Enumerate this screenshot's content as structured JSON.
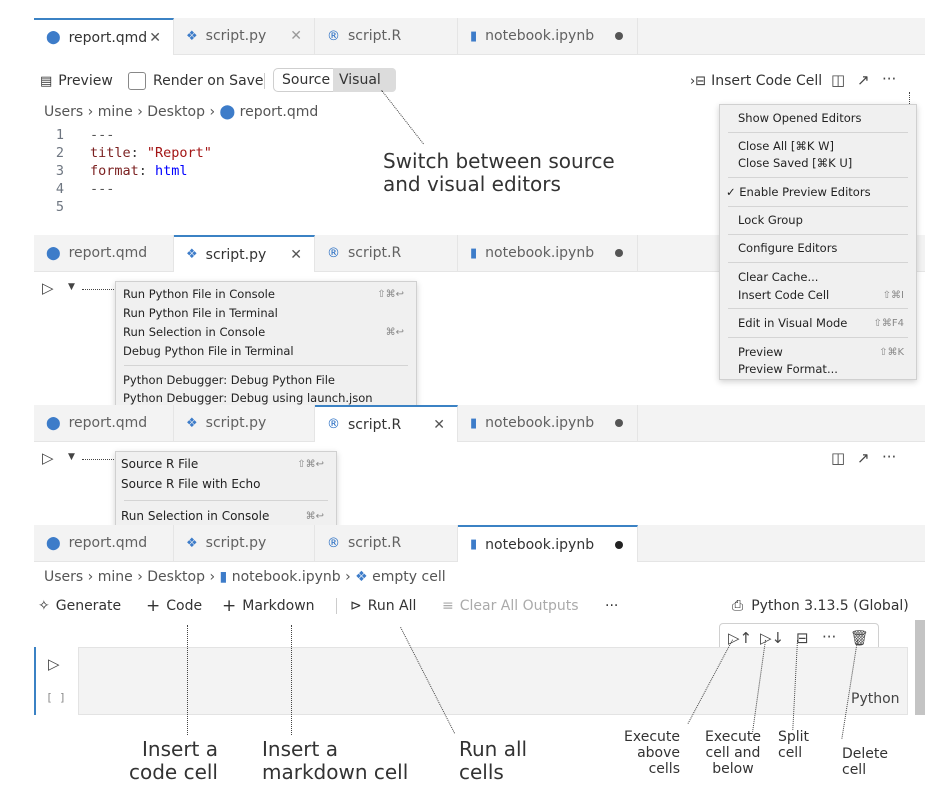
{
  "panel1": {
    "tabs": [
      {
        "label": "report.qmd",
        "close": "✕"
      },
      {
        "label": "script.py",
        "close": "✕"
      },
      {
        "label": "script.R"
      },
      {
        "label": "notebook.ipynb"
      }
    ],
    "toolbar": {
      "preview": "Preview",
      "render_on_save": "Render on Save",
      "source": "Source",
      "visual": "Visual",
      "insert_code_cell": "Insert Code Cell",
      "more": "···"
    },
    "breadcrumb": [
      "Users",
      "mine",
      "Desktop",
      "report.qmd"
    ],
    "code": [
      {
        "n": "1",
        "text": "---"
      },
      {
        "n": "2",
        "key": "title",
        "val": "\"Report\""
      },
      {
        "n": "3",
        "key": "format",
        "val": "html"
      },
      {
        "n": "4",
        "text": "---"
      },
      {
        "n": "5",
        "text": ""
      }
    ],
    "more_menu": [
      {
        "label": "Show Opened Editors",
        "sc": ""
      },
      {
        "label": "Close All [⌘K W]",
        "sc": ""
      },
      {
        "label": "Close Saved [⌘K U]",
        "sc": ""
      },
      {
        "label": "✓ Enable Preview Editors",
        "sc": ""
      },
      {
        "label": "Lock Group",
        "sc": ""
      },
      {
        "label": "Configure Editors",
        "sc": ""
      },
      {
        "label": "Clear Cache...",
        "sc": ""
      },
      {
        "label": "Insert Code Cell",
        "sc": "⇧⌘I"
      },
      {
        "label": "Edit in Visual Mode",
        "sc": "⇧⌘F4"
      },
      {
        "label": "Preview",
        "sc": "⇧⌘K"
      },
      {
        "label": "Preview Format...",
        "sc": ""
      }
    ]
  },
  "panel2": {
    "tabs": [
      {
        "label": "report.qmd"
      },
      {
        "label": "script.py",
        "close": "✕"
      },
      {
        "label": "script.R"
      },
      {
        "label": "notebook.ipynb"
      }
    ],
    "run_menu": [
      {
        "label": "Run Python File in Console",
        "sc": "⇧⌘↩"
      },
      {
        "label": "Run Python File in Terminal",
        "sc": ""
      },
      {
        "label": "Run Selection in Console",
        "sc": "⌘↩"
      },
      {
        "label": "Debug Python File in Terminal",
        "sc": ""
      },
      {
        "label": "Python Debugger: Debug Python File",
        "sc": ""
      },
      {
        "label": "Python Debugger: Debug using launch.json",
        "sc": ""
      }
    ]
  },
  "panel3": {
    "tabs": [
      {
        "label": "report.qmd"
      },
      {
        "label": "script.py"
      },
      {
        "label": "script.R",
        "close": "✕"
      },
      {
        "label": "notebook.ipynb"
      }
    ],
    "run_menu": [
      {
        "label": "Source R File",
        "sc": "⇧⌘↩"
      },
      {
        "label": "Source R File with Echo",
        "sc": ""
      },
      {
        "label": "Run Selection in Console",
        "sc": "⌘↩"
      }
    ],
    "more": "···"
  },
  "panel4": {
    "tabs": [
      {
        "label": "report.qmd"
      },
      {
        "label": "script.py"
      },
      {
        "label": "script.R"
      },
      {
        "label": "notebook.ipynb"
      }
    ],
    "breadcrumb": [
      "Users",
      "mine",
      "Desktop",
      "notebook.ipynb",
      "empty cell"
    ],
    "toolbar": {
      "generate": "Generate",
      "code": "Code",
      "markdown": "Markdown",
      "run_all": "Run All",
      "clear_all": "Clear All Outputs",
      "more": "···",
      "kernel": "Python 3.13.5 (Global)"
    },
    "cell": {
      "brackets": "[ ]",
      "lang": "Python"
    }
  },
  "callouts": {
    "switch": "Switch between source\nand visual editors",
    "insert_code": "Insert a\ncode cell",
    "insert_md": "Insert a\nmarkdown cell",
    "run_all": "Run all\ncells",
    "exec_above": "Execute\nabove\ncells",
    "exec_below": "Execute\ncell and\nbelow",
    "split": "Split\ncell",
    "delete": "Delete\ncell"
  },
  "colors": {
    "accent": "#3b82c4",
    "key": "#a31515",
    "keyname": "#7a1f1f",
    "value_string": "#a31515",
    "value_ident": "#0000ff"
  }
}
